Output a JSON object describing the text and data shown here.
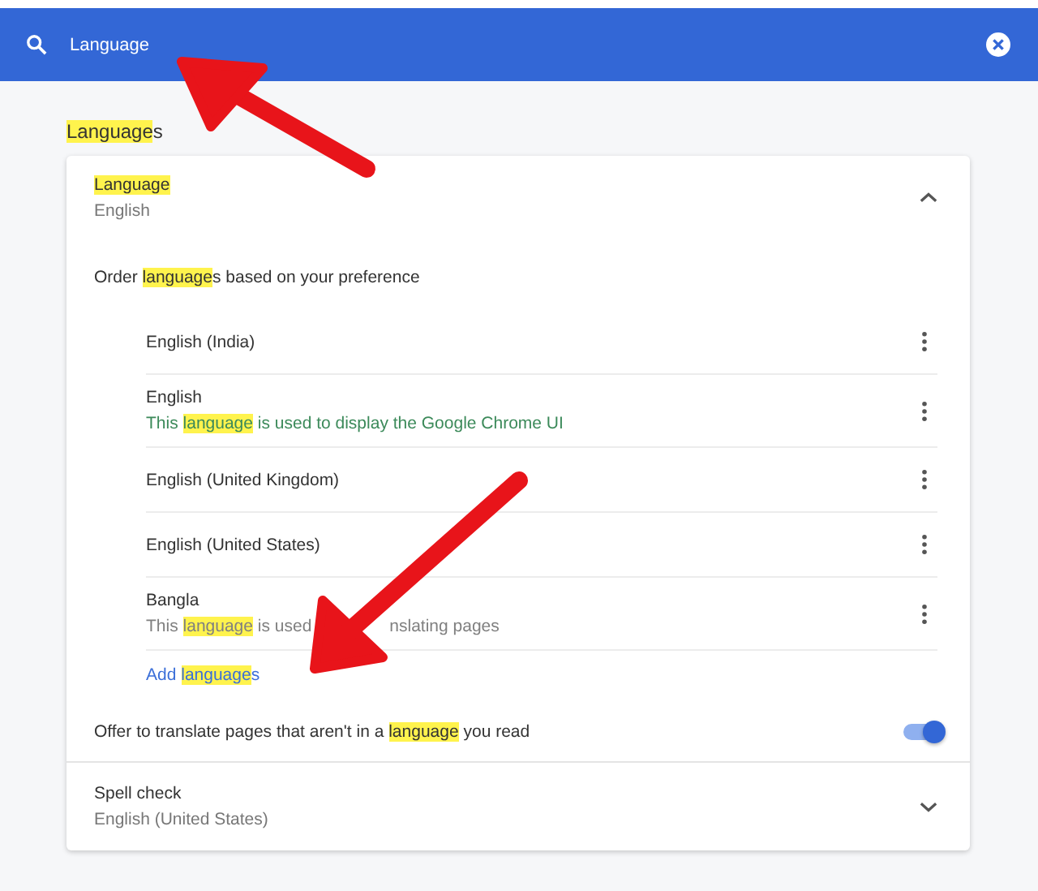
{
  "search_bar": {
    "value": "Language"
  },
  "section_title": [
    {
      "text": "Language",
      "highlight": true
    },
    {
      "text": "s",
      "highlight": false
    }
  ],
  "language_panel": {
    "title": [
      {
        "text": "Language",
        "highlight": true
      }
    ],
    "subtitle": "English",
    "expanded": true,
    "order_hint": [
      {
        "text": "Order ",
        "highlight": false
      },
      {
        "text": "language",
        "highlight": true
      },
      {
        "text": "s based on your preference",
        "highlight": false
      }
    ],
    "languages": [
      {
        "kind": "plain",
        "name": "English (India)"
      },
      {
        "kind": "ui",
        "name": "English",
        "note_parts": [
          [
            {
              "text": "This ",
              "highlight": false
            },
            {
              "text": "language",
              "highlight": true
            },
            {
              "text": " is used to display the Google Chrome UI",
              "highlight": false
            }
          ]
        ]
      },
      {
        "kind": "plain",
        "name": "English (United Kingdom)"
      },
      {
        "kind": "plain",
        "name": "English (United States)"
      },
      {
        "kind": "translate",
        "name": "Bangla",
        "note_parts": [
          [
            {
              "text": "This ",
              "highlight": false
            },
            {
              "text": "language",
              "highlight": true
            },
            {
              "text": " is used",
              "highlight": false
            }
          ],
          [
            {
              "text": "nslating pages",
              "highlight": false
            }
          ]
        ]
      }
    ],
    "add_link": [
      {
        "text": "Add ",
        "highlight": false
      },
      {
        "text": "language",
        "highlight": true
      },
      {
        "text": "s",
        "highlight": false
      }
    ],
    "translate_offer": {
      "label": [
        {
          "text": "Offer to translate pages that aren't in a ",
          "highlight": false
        },
        {
          "text": "language",
          "highlight": true
        },
        {
          "text": " you read",
          "highlight": false
        }
      ],
      "on": true
    }
  },
  "spell_check_panel": {
    "title": "Spell check",
    "subtitle": "English (United States)",
    "expanded": false
  }
}
